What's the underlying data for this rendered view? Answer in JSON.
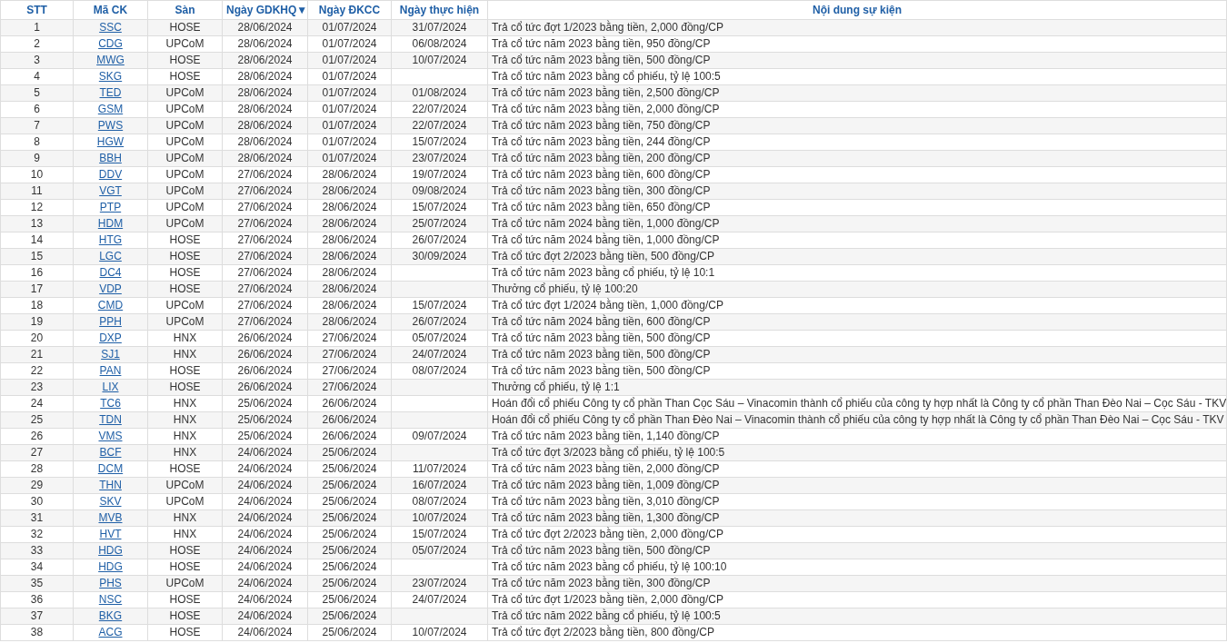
{
  "table": {
    "columns": [
      "STT",
      "Mã CK",
      "Sàn",
      "Ngày GDKHQ▼",
      "Ngày ĐKCC",
      "Ngày thực hiện",
      "Nội dung sự kiện"
    ],
    "rows": [
      {
        "stt": "1",
        "code": "SSC",
        "exchange": "HOSE",
        "ex_date": "28/06/2024",
        "record_date": "01/07/2024",
        "pay_date": "31/07/2024",
        "content": "Trả cổ tức đợt 1/2023 bằng tiền, 2,000 đồng/CP"
      },
      {
        "stt": "2",
        "code": "CDG",
        "exchange": "UPCoM",
        "ex_date": "28/06/2024",
        "record_date": "01/07/2024",
        "pay_date": "06/08/2024",
        "content": "Trả cổ tức năm 2023 bằng tiền, 950 đồng/CP"
      },
      {
        "stt": "3",
        "code": "MWG",
        "exchange": "HOSE",
        "ex_date": "28/06/2024",
        "record_date": "01/07/2024",
        "pay_date": "10/07/2024",
        "content": "Trả cổ tức năm 2023 bằng tiền, 500 đồng/CP"
      },
      {
        "stt": "4",
        "code": "SKG",
        "exchange": "HOSE",
        "ex_date": "28/06/2024",
        "record_date": "01/07/2024",
        "content": "Trả cổ tức năm 2023 bằng cổ phiếu, tỷ lệ 100:5"
      },
      {
        "stt": "5",
        "code": "TED",
        "exchange": "UPCoM",
        "ex_date": "28/06/2024",
        "record_date": "01/07/2024",
        "pay_date": "01/08/2024",
        "content": "Trả cổ tức năm 2023 bằng tiền, 2,500 đồng/CP"
      },
      {
        "stt": "6",
        "code": "GSM",
        "exchange": "UPCoM",
        "ex_date": "28/06/2024",
        "record_date": "01/07/2024",
        "pay_date": "22/07/2024",
        "content": "Trả cổ tức năm 2023 bằng tiền, 2,000 đồng/CP"
      },
      {
        "stt": "7",
        "code": "PWS",
        "exchange": "UPCoM",
        "ex_date": "28/06/2024",
        "record_date": "01/07/2024",
        "pay_date": "22/07/2024",
        "content": "Trả cổ tức năm 2023 bằng tiền, 750 đồng/CP"
      },
      {
        "stt": "8",
        "code": "HGW",
        "exchange": "UPCoM",
        "ex_date": "28/06/2024",
        "record_date": "01/07/2024",
        "pay_date": "15/07/2024",
        "content": "Trả cổ tức năm 2023 bằng tiền, 244 đồng/CP"
      },
      {
        "stt": "9",
        "code": "BBH",
        "exchange": "UPCoM",
        "ex_date": "28/06/2024",
        "record_date": "01/07/2024",
        "pay_date": "23/07/2024",
        "content": "Trả cổ tức năm 2023 bằng tiền, 200 đồng/CP"
      },
      {
        "stt": "10",
        "code": "DDV",
        "exchange": "UPCoM",
        "ex_date": "27/06/2024",
        "record_date": "28/06/2024",
        "pay_date": "19/07/2024",
        "content": "Trả cổ tức năm 2023 bằng tiền, 600 đồng/CP"
      },
      {
        "stt": "11",
        "code": "VGT",
        "exchange": "UPCoM",
        "ex_date": "27/06/2024",
        "record_date": "28/06/2024",
        "pay_date": "09/08/2024",
        "content": "Trả cổ tức năm 2023 bằng tiền, 300 đồng/CP"
      },
      {
        "stt": "12",
        "code": "PTP",
        "exchange": "UPCoM",
        "ex_date": "27/06/2024",
        "record_date": "28/06/2024",
        "pay_date": "15/07/2024",
        "content": "Trả cổ tức năm 2023 bằng tiền, 650 đồng/CP"
      },
      {
        "stt": "13",
        "code": "HDM",
        "exchange": "UPCoM",
        "ex_date": "27/06/2024",
        "record_date": "28/06/2024",
        "pay_date": "25/07/2024",
        "content": "Trả cổ tức năm 2024 bằng tiền, 1,000 đồng/CP"
      },
      {
        "stt": "14",
        "code": "HTG",
        "exchange": "HOSE",
        "ex_date": "27/06/2024",
        "record_date": "28/06/2024",
        "pay_date": "26/07/2024",
        "content": "Trả cổ tức năm 2024 bằng tiền, 1,000 đồng/CP"
      },
      {
        "stt": "15",
        "code": "LGC",
        "exchange": "HOSE",
        "ex_date": "27/06/2024",
        "record_date": "28/06/2024",
        "pay_date": "30/09/2024",
        "content": "Trả cổ tức đợt 2/2023 bằng tiền, 500 đồng/CP"
      },
      {
        "stt": "16",
        "code": "DC4",
        "exchange": "HOSE",
        "ex_date": "27/06/2024",
        "record_date": "28/06/2024",
        "content": "Trả cổ tức năm 2023 bằng cổ phiếu, tỷ lệ 10:1"
      },
      {
        "stt": "17",
        "code": "VDP",
        "exchange": "HOSE",
        "ex_date": "27/06/2024",
        "record_date": "28/06/2024",
        "content": "Thưởng cổ phiếu, tỷ lệ 100:20"
      },
      {
        "stt": "18",
        "code": "CMD",
        "exchange": "UPCoM",
        "ex_date": "27/06/2024",
        "record_date": "28/06/2024",
        "pay_date": "15/07/2024",
        "content": "Trả cổ tức đợt 1/2024 bằng tiền, 1,000 đồng/CP"
      },
      {
        "stt": "19",
        "code": "PPH",
        "exchange": "UPCoM",
        "ex_date": "27/06/2024",
        "record_date": "28/06/2024",
        "pay_date": "26/07/2024",
        "content": "Trả cổ tức năm 2024 bằng tiền, 600 đồng/CP"
      },
      {
        "stt": "20",
        "code": "DXP",
        "exchange": "HNX",
        "ex_date": "26/06/2024",
        "record_date": "27/06/2024",
        "pay_date": "05/07/2024",
        "content": "Trả cổ tức năm 2023 bằng tiền, 500 đồng/CP"
      },
      {
        "stt": "21",
        "code": "SJ1",
        "exchange": "HNX",
        "ex_date": "26/06/2024",
        "record_date": "27/06/2024",
        "pay_date": "24/07/2024",
        "content": "Trả cổ tức năm 2023 bằng tiền, 500 đồng/CP"
      },
      {
        "stt": "22",
        "code": "PAN",
        "exchange": "HOSE",
        "ex_date": "26/06/2024",
        "record_date": "27/06/2024",
        "pay_date": "08/07/2024",
        "content": "Trả cổ tức năm 2023 bằng tiền, 500 đồng/CP"
      },
      {
        "stt": "23",
        "code": "LIX",
        "exchange": "HOSE",
        "ex_date": "26/06/2024",
        "record_date": "27/06/2024",
        "content": "Thưởng cổ phiếu, tỷ lệ 1:1"
      },
      {
        "stt": "24",
        "code": "TC6",
        "exchange": "HNX",
        "ex_date": "25/06/2024",
        "record_date": "26/06/2024",
        "content": "Hoán đổi cổ phiếu Công ty cổ phần Than Cọc Sáu – Vinacomin thành cổ phiếu của công ty hợp nhất là Công ty cổ phần Than Đèo Nai – Cọc Sáu - TKV"
      },
      {
        "stt": "25",
        "code": "TDN",
        "exchange": "HNX",
        "ex_date": "25/06/2024",
        "record_date": "26/06/2024",
        "content": "Hoán đổi cổ phiếu Công ty cổ phần Than Đèo Nai – Vinacomin thành cổ phiếu của công ty hợp nhất là Công ty cổ phần Than Đèo Nai – Cọc Sáu - TKV"
      },
      {
        "stt": "26",
        "code": "VMS",
        "exchange": "HNX",
        "ex_date": "25/06/2024",
        "record_date": "26/06/2024",
        "pay_date": "09/07/2024",
        "content": "Trả cổ tức năm 2023 bằng tiền, 1,140 đồng/CP"
      },
      {
        "stt": "27",
        "code": "BCF",
        "exchange": "HNX",
        "ex_date": "24/06/2024",
        "record_date": "25/06/2024",
        "content": "Trả cổ tức đợt 3/2023 bằng cổ phiếu, tỷ lệ 100:5"
      },
      {
        "stt": "28",
        "code": "DCM",
        "exchange": "HOSE",
        "ex_date": "24/06/2024",
        "record_date": "25/06/2024",
        "pay_date": "11/07/2024",
        "content": "Trả cổ tức năm 2023 bằng tiền, 2,000 đồng/CP"
      },
      {
        "stt": "29",
        "code": "THN",
        "exchange": "UPCoM",
        "ex_date": "24/06/2024",
        "record_date": "25/06/2024",
        "pay_date": "16/07/2024",
        "content": "Trả cổ tức năm 2023 bằng tiền, 1,009 đồng/CP"
      },
      {
        "stt": "30",
        "code": "SKV",
        "exchange": "UPCoM",
        "ex_date": "24/06/2024",
        "record_date": "25/06/2024",
        "pay_date": "08/07/2024",
        "content": "Trả cổ tức năm 2023 bằng tiền, 3,010 đồng/CP"
      },
      {
        "stt": "31",
        "code": "MVB",
        "exchange": "HNX",
        "ex_date": "24/06/2024",
        "record_date": "25/06/2024",
        "pay_date": "10/07/2024",
        "content": "Trả cổ tức năm 2023 bằng tiền, 1,300 đồng/CP"
      },
      {
        "stt": "32",
        "code": "HVT",
        "exchange": "HNX",
        "ex_date": "24/06/2024",
        "record_date": "25/06/2024",
        "pay_date": "15/07/2024",
        "content": "Trả cổ tức đợt 2/2023 bằng tiền, 2,000 đồng/CP"
      },
      {
        "stt": "33",
        "code": "HDG",
        "exchange": "HOSE",
        "ex_date": "24/06/2024",
        "record_date": "25/06/2024",
        "pay_date": "05/07/2024",
        "content": "Trả cổ tức năm 2023 bằng tiền, 500 đồng/CP"
      },
      {
        "stt": "34",
        "code": "HDG",
        "exchange": "HOSE",
        "ex_date": "24/06/2024",
        "record_date": "25/06/2024",
        "content": "Trả cổ tức năm 2023 bằng cổ phiếu, tỷ lệ 100:10"
      },
      {
        "stt": "35",
        "code": "PHS",
        "exchange": "UPCoM",
        "ex_date": "24/06/2024",
        "record_date": "25/06/2024",
        "pay_date": "23/07/2024",
        "content": "Trả cổ tức năm 2023 bằng tiền, 300 đồng/CP"
      },
      {
        "stt": "36",
        "code": "NSC",
        "exchange": "HOSE",
        "ex_date": "24/06/2024",
        "record_date": "25/06/2024",
        "pay_date": "24/07/2024",
        "content": "Trả cổ tức đợt 1/2023 bằng tiền, 2,000 đồng/CP"
      },
      {
        "stt": "37",
        "code": "BKG",
        "exchange": "HOSE",
        "ex_date": "24/06/2024",
        "record_date": "25/06/2024",
        "content": "Trả cổ tức năm 2022 bằng cổ phiếu, tỷ lệ 100:5"
      },
      {
        "stt": "38",
        "code": "ACG",
        "exchange": "HOSE",
        "ex_date": "24/06/2024",
        "record_date": "25/06/2024",
        "pay_date": "10/07/2024",
        "content": "Trả cổ tức đợt 2/2023 bằng tiền, 800 đồng/CP"
      }
    ]
  }
}
